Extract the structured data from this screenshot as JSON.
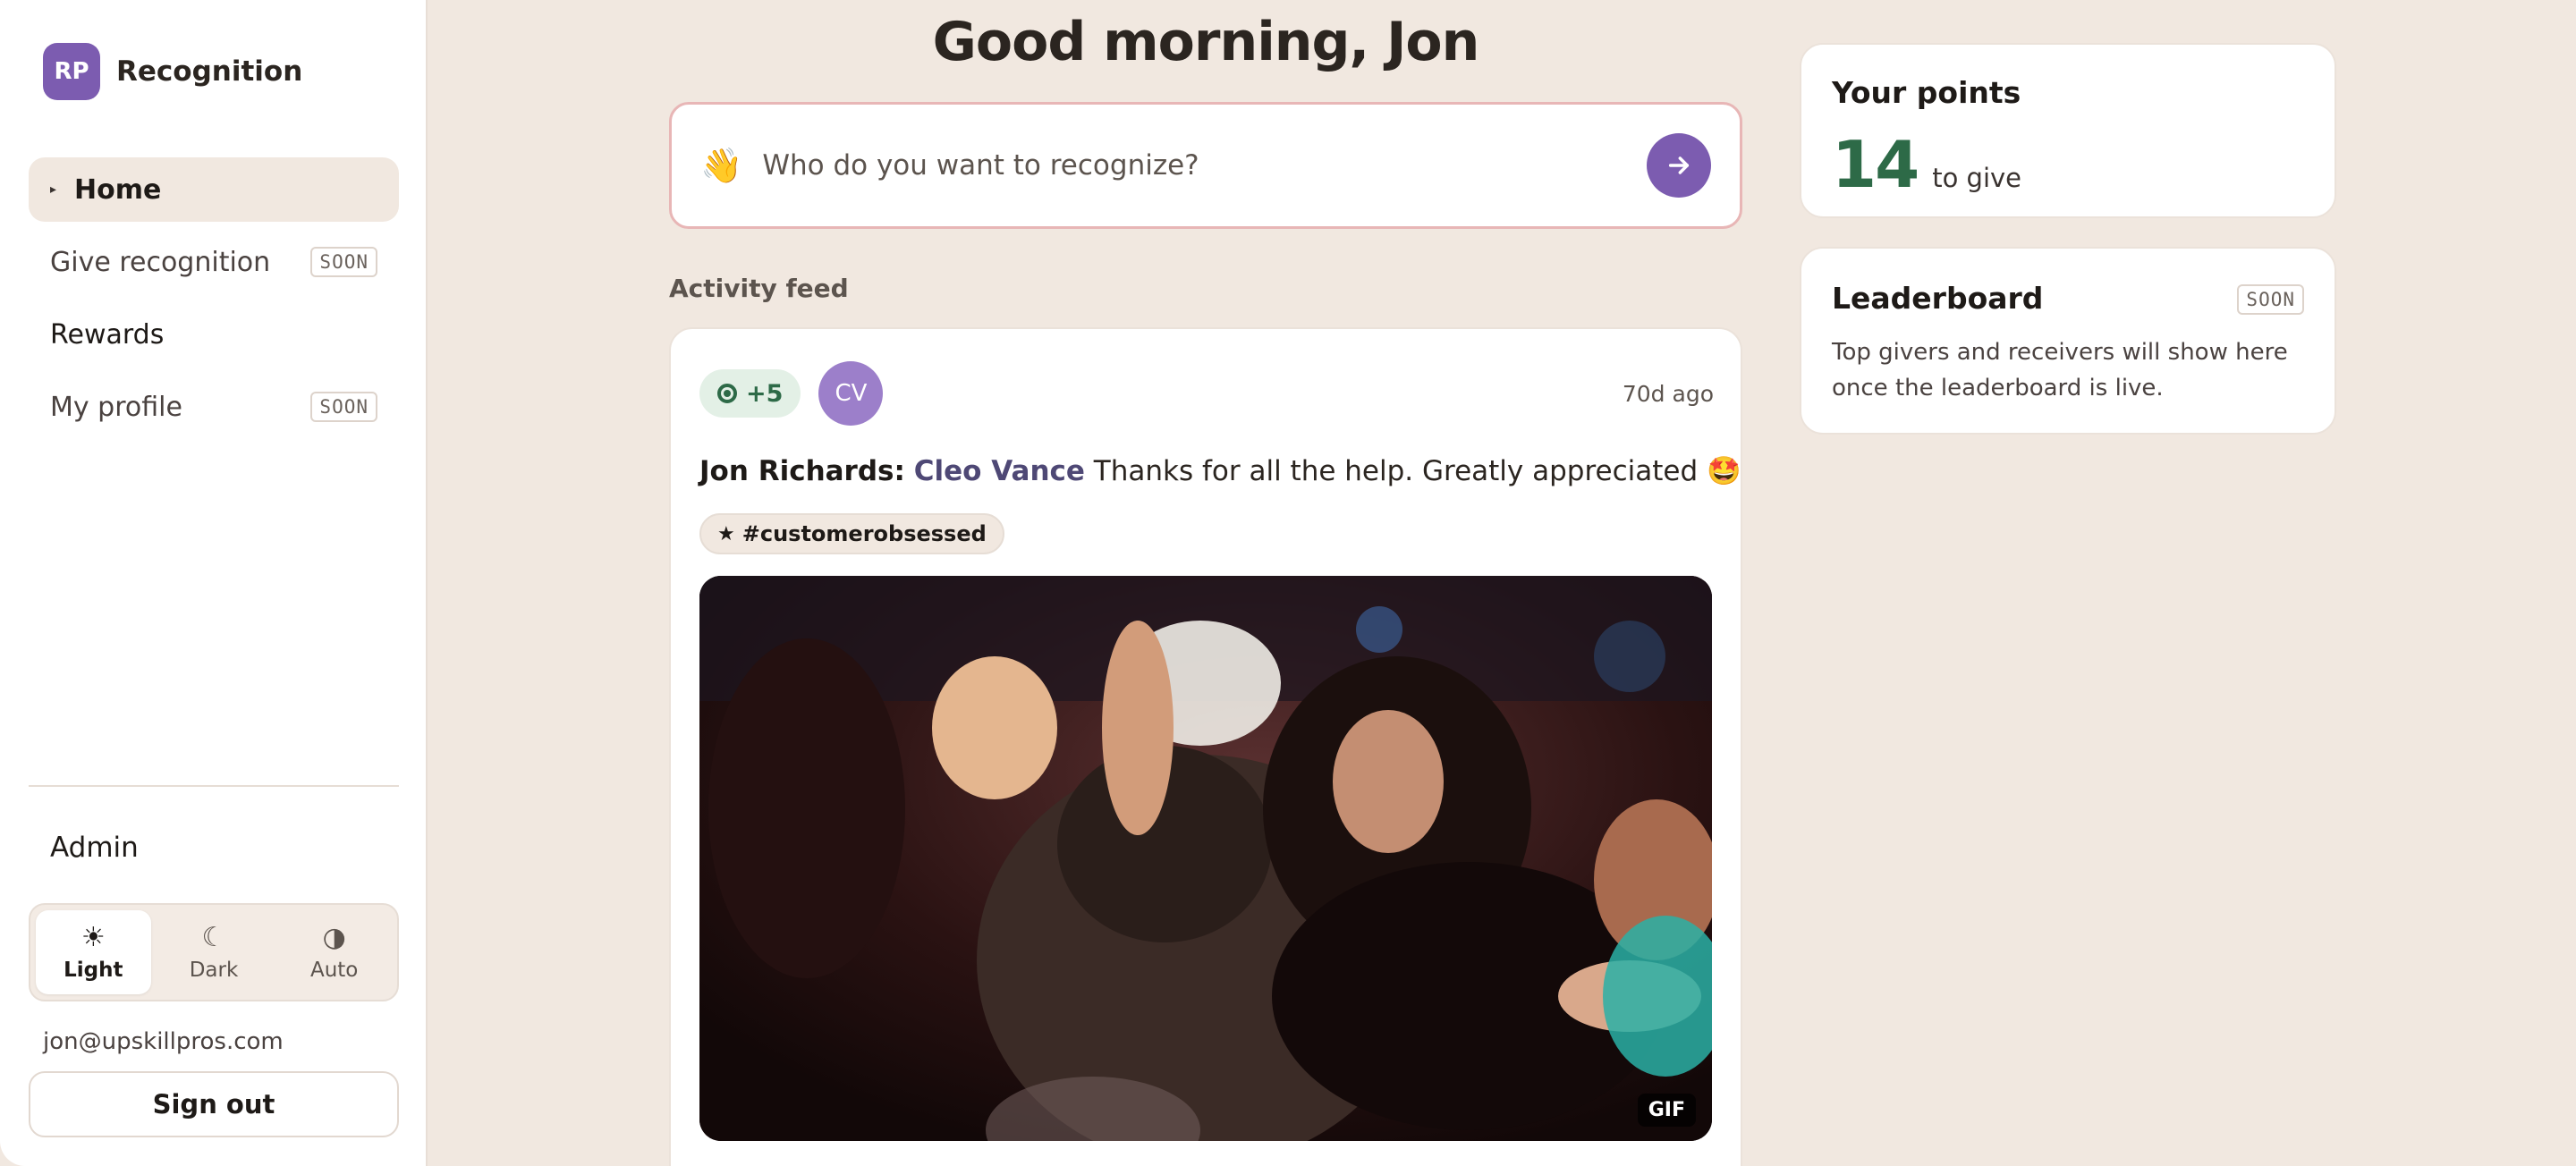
{
  "brand": {
    "initials": "RP",
    "name": "Recognition",
    "logo_color": "#7c5cb0"
  },
  "nav": {
    "items": [
      {
        "label": "Home",
        "badge": ""
      },
      {
        "label": "Give recognition",
        "badge": "SOON"
      },
      {
        "label": "Rewards",
        "badge": ""
      },
      {
        "label": "My profile",
        "badge": "SOON"
      }
    ],
    "active_index": 0
  },
  "admin_label": "Admin",
  "theme": {
    "options": [
      {
        "label": "Light",
        "icon": "sun-icon"
      },
      {
        "label": "Dark",
        "icon": "moon-icon"
      },
      {
        "label": "Auto",
        "icon": "half-circle-icon"
      }
    ],
    "selected": "Light"
  },
  "user": {
    "email": "jon@upskillpros.com",
    "sign_out_label": "Sign out"
  },
  "main": {
    "greeting": "Good morning, Jon",
    "compose": {
      "emoji": "👋",
      "placeholder": "Who do you want to recognize?"
    },
    "feed_label": "Activity feed",
    "feed": [
      {
        "points": "+5",
        "recipient_initials": "CV",
        "time": "70d ago",
        "giver": "Jon Richards:",
        "recipient": "Cleo Vance",
        "message": "Thanks for all the help. Greatly appreciated 🤩",
        "tag": "#customerobsessed",
        "media_badge": "GIF"
      }
    ]
  },
  "points_card": {
    "title": "Your points",
    "value": "14",
    "unit": "to give",
    "value_color": "#2d6a47"
  },
  "leaderboard": {
    "title": "Leaderboard",
    "badge": "SOON",
    "description": "Top givers and receivers will show here once the leaderboard is live."
  },
  "colors": {
    "background": "#f1e8e0",
    "accent": "#7c5cb0",
    "positive": "#2d6a47"
  }
}
